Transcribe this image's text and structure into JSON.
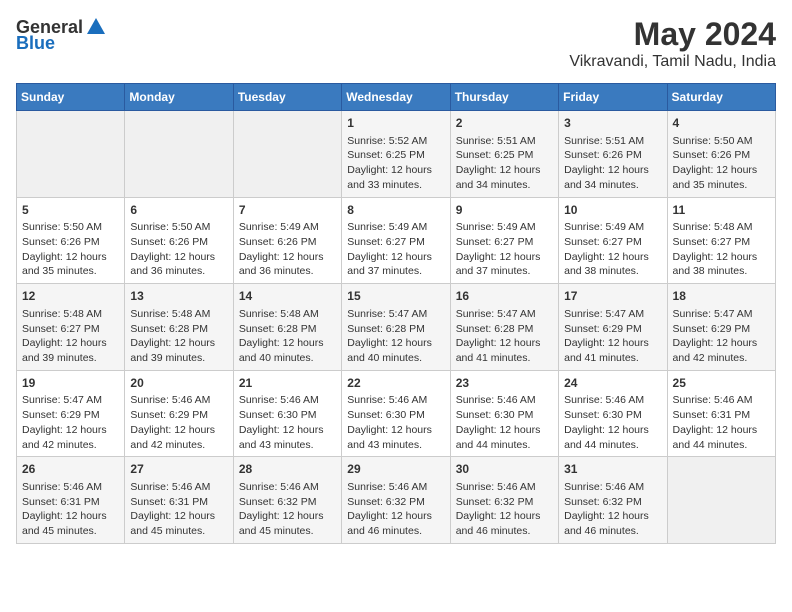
{
  "header": {
    "logo_general": "General",
    "logo_blue": "Blue",
    "title": "May 2024",
    "subtitle": "Vikravandi, Tamil Nadu, India"
  },
  "calendar": {
    "days_of_week": [
      "Sunday",
      "Monday",
      "Tuesday",
      "Wednesday",
      "Thursday",
      "Friday",
      "Saturday"
    ],
    "weeks": [
      [
        {
          "day": "",
          "content": ""
        },
        {
          "day": "",
          "content": ""
        },
        {
          "day": "",
          "content": ""
        },
        {
          "day": "1",
          "content": "Sunrise: 5:52 AM\nSunset: 6:25 PM\nDaylight: 12 hours\nand 33 minutes."
        },
        {
          "day": "2",
          "content": "Sunrise: 5:51 AM\nSunset: 6:25 PM\nDaylight: 12 hours\nand 34 minutes."
        },
        {
          "day": "3",
          "content": "Sunrise: 5:51 AM\nSunset: 6:26 PM\nDaylight: 12 hours\nand 34 minutes."
        },
        {
          "day": "4",
          "content": "Sunrise: 5:50 AM\nSunset: 6:26 PM\nDaylight: 12 hours\nand 35 minutes."
        }
      ],
      [
        {
          "day": "5",
          "content": "Sunrise: 5:50 AM\nSunset: 6:26 PM\nDaylight: 12 hours\nand 35 minutes."
        },
        {
          "day": "6",
          "content": "Sunrise: 5:50 AM\nSunset: 6:26 PM\nDaylight: 12 hours\nand 36 minutes."
        },
        {
          "day": "7",
          "content": "Sunrise: 5:49 AM\nSunset: 6:26 PM\nDaylight: 12 hours\nand 36 minutes."
        },
        {
          "day": "8",
          "content": "Sunrise: 5:49 AM\nSunset: 6:27 PM\nDaylight: 12 hours\nand 37 minutes."
        },
        {
          "day": "9",
          "content": "Sunrise: 5:49 AM\nSunset: 6:27 PM\nDaylight: 12 hours\nand 37 minutes."
        },
        {
          "day": "10",
          "content": "Sunrise: 5:49 AM\nSunset: 6:27 PM\nDaylight: 12 hours\nand 38 minutes."
        },
        {
          "day": "11",
          "content": "Sunrise: 5:48 AM\nSunset: 6:27 PM\nDaylight: 12 hours\nand 38 minutes."
        }
      ],
      [
        {
          "day": "12",
          "content": "Sunrise: 5:48 AM\nSunset: 6:27 PM\nDaylight: 12 hours\nand 39 minutes."
        },
        {
          "day": "13",
          "content": "Sunrise: 5:48 AM\nSunset: 6:28 PM\nDaylight: 12 hours\nand 39 minutes."
        },
        {
          "day": "14",
          "content": "Sunrise: 5:48 AM\nSunset: 6:28 PM\nDaylight: 12 hours\nand 40 minutes."
        },
        {
          "day": "15",
          "content": "Sunrise: 5:47 AM\nSunset: 6:28 PM\nDaylight: 12 hours\nand 40 minutes."
        },
        {
          "day": "16",
          "content": "Sunrise: 5:47 AM\nSunset: 6:28 PM\nDaylight: 12 hours\nand 41 minutes."
        },
        {
          "day": "17",
          "content": "Sunrise: 5:47 AM\nSunset: 6:29 PM\nDaylight: 12 hours\nand 41 minutes."
        },
        {
          "day": "18",
          "content": "Sunrise: 5:47 AM\nSunset: 6:29 PM\nDaylight: 12 hours\nand 42 minutes."
        }
      ],
      [
        {
          "day": "19",
          "content": "Sunrise: 5:47 AM\nSunset: 6:29 PM\nDaylight: 12 hours\nand 42 minutes."
        },
        {
          "day": "20",
          "content": "Sunrise: 5:46 AM\nSunset: 6:29 PM\nDaylight: 12 hours\nand 42 minutes."
        },
        {
          "day": "21",
          "content": "Sunrise: 5:46 AM\nSunset: 6:30 PM\nDaylight: 12 hours\nand 43 minutes."
        },
        {
          "day": "22",
          "content": "Sunrise: 5:46 AM\nSunset: 6:30 PM\nDaylight: 12 hours\nand 43 minutes."
        },
        {
          "day": "23",
          "content": "Sunrise: 5:46 AM\nSunset: 6:30 PM\nDaylight: 12 hours\nand 44 minutes."
        },
        {
          "day": "24",
          "content": "Sunrise: 5:46 AM\nSunset: 6:30 PM\nDaylight: 12 hours\nand 44 minutes."
        },
        {
          "day": "25",
          "content": "Sunrise: 5:46 AM\nSunset: 6:31 PM\nDaylight: 12 hours\nand 44 minutes."
        }
      ],
      [
        {
          "day": "26",
          "content": "Sunrise: 5:46 AM\nSunset: 6:31 PM\nDaylight: 12 hours\nand 45 minutes."
        },
        {
          "day": "27",
          "content": "Sunrise: 5:46 AM\nSunset: 6:31 PM\nDaylight: 12 hours\nand 45 minutes."
        },
        {
          "day": "28",
          "content": "Sunrise: 5:46 AM\nSunset: 6:32 PM\nDaylight: 12 hours\nand 45 minutes."
        },
        {
          "day": "29",
          "content": "Sunrise: 5:46 AM\nSunset: 6:32 PM\nDaylight: 12 hours\nand 46 minutes."
        },
        {
          "day": "30",
          "content": "Sunrise: 5:46 AM\nSunset: 6:32 PM\nDaylight: 12 hours\nand 46 minutes."
        },
        {
          "day": "31",
          "content": "Sunrise: 5:46 AM\nSunset: 6:32 PM\nDaylight: 12 hours\nand 46 minutes."
        },
        {
          "day": "",
          "content": ""
        }
      ]
    ]
  }
}
